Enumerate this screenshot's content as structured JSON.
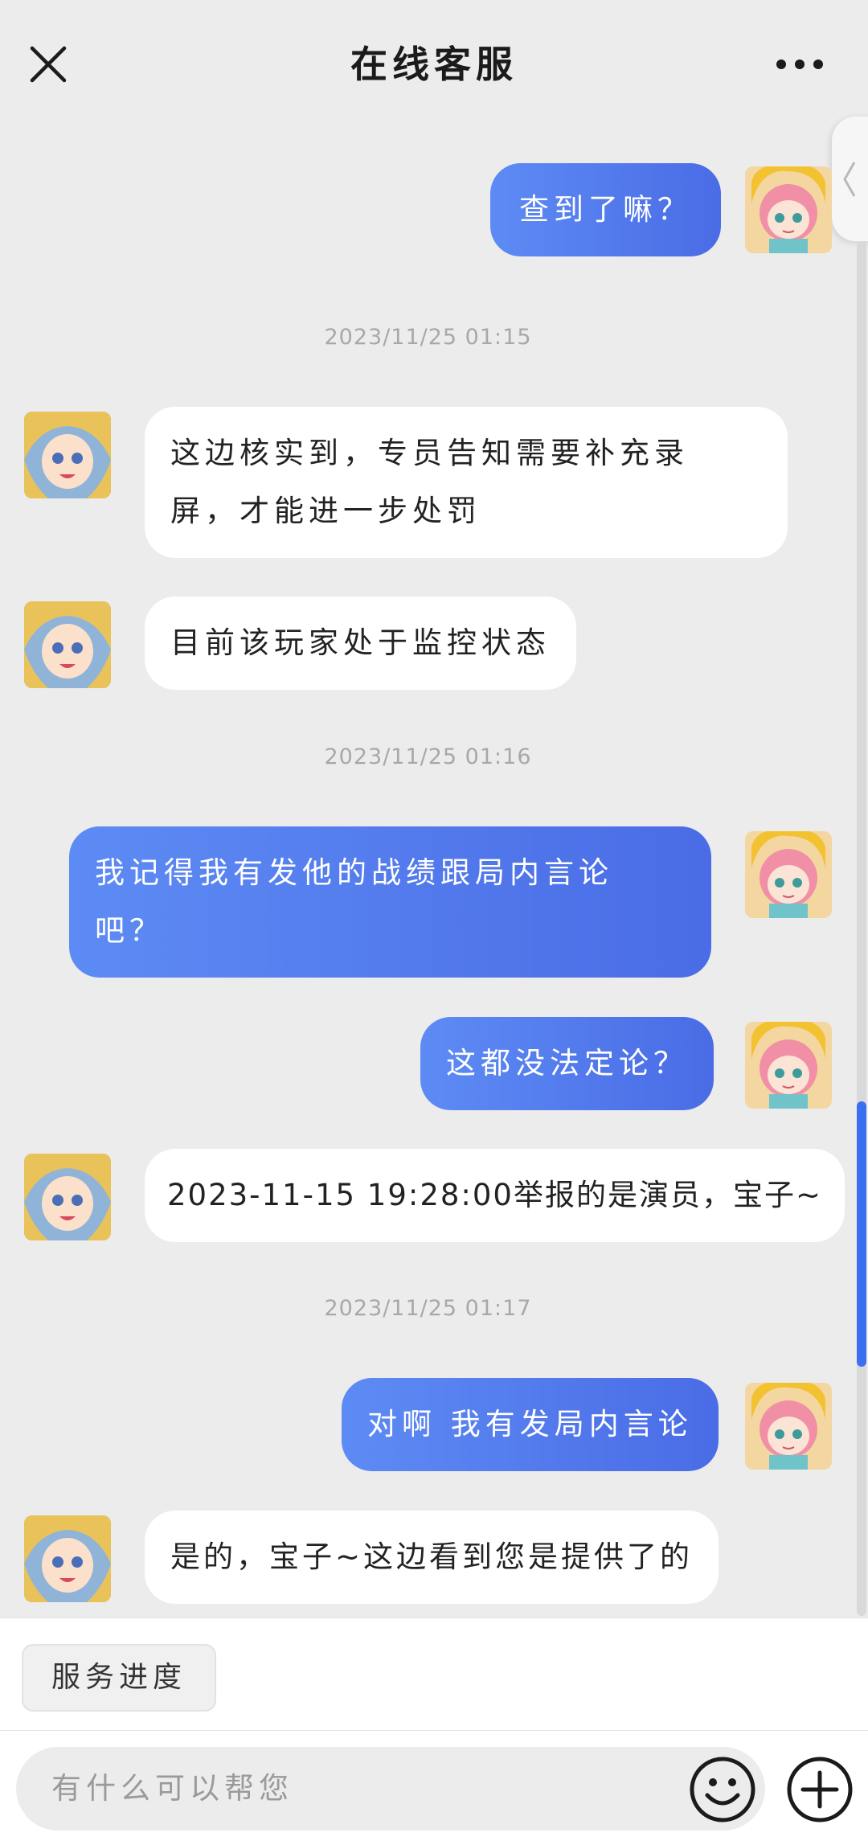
{
  "header": {
    "title": "在线客服",
    "close_icon": "close-icon",
    "more_icon": "more-icon"
  },
  "side_tab": {
    "icon": "chevron-left-icon"
  },
  "colors": {
    "background": "#ececec",
    "bubble_right_start": "#5d8bf4",
    "bubble_right_end": "#4a6ce6",
    "bubble_left": "#ffffff",
    "scroll_thumb": "#3a6ff0"
  },
  "messages": [
    {
      "type": "user",
      "text": "查到了嘛？"
    },
    {
      "type": "timestamp",
      "text": "2023/11/25 01:15"
    },
    {
      "type": "agent",
      "line1": "这边核实到，专员告知需要补充录",
      "line2": "屏，才能进一步处罚"
    },
    {
      "type": "agent",
      "text": "目前该玩家处于监控状态"
    },
    {
      "type": "timestamp",
      "text": "2023/11/25 01:16"
    },
    {
      "type": "user",
      "line1": "我记得我有发他的战绩跟局内言论",
      "line2": "吧？"
    },
    {
      "type": "user",
      "text": "这都没法定论？"
    },
    {
      "type": "agent",
      "text": "2023-11-15 19:28:00举报的是演员，宝子~"
    },
    {
      "type": "timestamp",
      "text": "2023/11/25 01:17"
    },
    {
      "type": "user",
      "text": "对啊 我有发局内言论"
    },
    {
      "type": "agent",
      "text": "是的，宝子~这边看到您是提供了的"
    }
  ],
  "quick_actions": {
    "service_progress": "服务进度"
  },
  "input": {
    "placeholder": "有什么可以帮您",
    "emoji_icon": "smiley-icon",
    "plus_icon": "plus-circle-icon"
  }
}
